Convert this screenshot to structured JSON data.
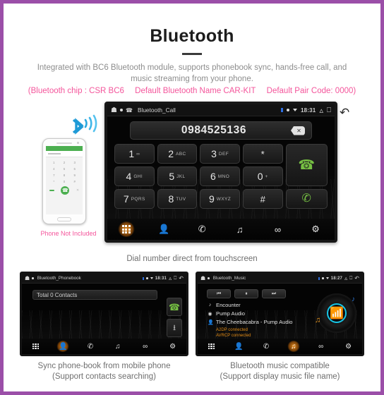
{
  "theme": {
    "border_color": "#9b4fa8",
    "pink": "#f4559b",
    "orange_accent": "#e08a16",
    "green_call": "#76c043",
    "cyan_ring": "#17c6e6"
  },
  "header": {
    "title": "Bluetooth",
    "description_line1": "Integrated with BC6 Bluetooth module, supports phonebook sync, hands-free call, and",
    "description_line2": "music streaming from your phone.",
    "spec_chip": "(Bluetooth chip : CSR BC6",
    "spec_name": "Default Bluetooth Name CAR-KIT",
    "spec_code": "Default Pair Code: 0000)"
  },
  "phone_mock": {
    "note": "Phone Not Included",
    "bluetooth_icon": "bluetooth-signal-icon",
    "keys": [
      "1",
      "2",
      "3",
      "4",
      "5",
      "6",
      "7",
      "8",
      "9",
      "*",
      "0",
      "#"
    ]
  },
  "dialer": {
    "statusbar": {
      "home_icon": "home-icon",
      "title": "Bluetooth_Call",
      "time": "18:31",
      "chevron_icon": "chevron-up-icon",
      "window_icon": "window-icon",
      "back_icon": "back-arrow-icon"
    },
    "number": "0984525136",
    "backspace_icon": "backspace-icon",
    "keys": [
      {
        "digit": "1",
        "letters": "∞"
      },
      {
        "digit": "2",
        "letters": "ABC"
      },
      {
        "digit": "3",
        "letters": "DEF"
      },
      {
        "digit": "*",
        "letters": ""
      },
      {
        "digit": "4",
        "letters": "GHI"
      },
      {
        "digit": "5",
        "letters": "JKL"
      },
      {
        "digit": "6",
        "letters": "MNO"
      },
      {
        "digit": "0",
        "letters": "+"
      },
      {
        "digit": "7",
        "letters": "PQRS"
      },
      {
        "digit": "8",
        "letters": "TUV"
      },
      {
        "digit": "9",
        "letters": "WXYZ"
      },
      {
        "digit": "#",
        "letters": ""
      }
    ],
    "call_button_icon": "phone-call-icon",
    "call_history_button_icon": "phone-history-icon",
    "nav": [
      {
        "name": "keypad",
        "icon": "keypad-icon",
        "active": true
      },
      {
        "name": "contacts",
        "icon": "person-icon",
        "active": false
      },
      {
        "name": "call-log",
        "icon": "phone-log-icon",
        "active": false
      },
      {
        "name": "music",
        "icon": "music-note-icon",
        "active": false
      },
      {
        "name": "pair",
        "icon": "link-icon",
        "active": false
      },
      {
        "name": "settings",
        "icon": "gear-icon",
        "active": false
      }
    ],
    "caption": "Dial number direct from touchscreen"
  },
  "phonebook": {
    "statusbar": {
      "title": "Bluetooth_Phonebook",
      "time": "18:31"
    },
    "search_text": "Total 0 Contacts",
    "call_button_icon": "phone-call-icon",
    "download_button_icon": "download-icon",
    "nav": [
      {
        "name": "keypad",
        "icon": "keypad-icon",
        "active": false
      },
      {
        "name": "contacts",
        "icon": "person-icon",
        "active": true
      },
      {
        "name": "call-log",
        "icon": "phone-log-icon",
        "active": false
      },
      {
        "name": "music",
        "icon": "music-note-icon",
        "active": false
      },
      {
        "name": "pair",
        "icon": "link-icon",
        "active": false
      },
      {
        "name": "settings",
        "icon": "gear-icon",
        "active": false
      }
    ],
    "caption_line1": "Sync phone-book from mobile phone",
    "caption_line2": "(Support contacts searching)"
  },
  "music": {
    "statusbar": {
      "title": "Bluetooth_Music",
      "time": "18:27"
    },
    "controls": [
      {
        "name": "previous",
        "icon": "⏮"
      },
      {
        "name": "pause",
        "icon": "⏸"
      },
      {
        "name": "next",
        "icon": "⏭"
      }
    ],
    "track_title": "Encounter",
    "album": "Pump Audio",
    "artist": "The Cheebacabra - Pump Audio",
    "a2dp_status": "A2DP connected",
    "avrcp_status": "AVRCP connected",
    "disc_icon": "bluetooth-disc-icon",
    "nav": [
      {
        "name": "keypad",
        "icon": "keypad-icon",
        "active": false
      },
      {
        "name": "contacts",
        "icon": "person-icon",
        "active": false
      },
      {
        "name": "call-log",
        "icon": "phone-log-icon",
        "active": false
      },
      {
        "name": "music",
        "icon": "music-note-icon",
        "active": true
      },
      {
        "name": "pair",
        "icon": "link-icon",
        "active": false
      },
      {
        "name": "settings",
        "icon": "gear-icon",
        "active": false
      }
    ],
    "caption_line1": "Bluetooth music compatible",
    "caption_line2": "(Support display music file name)"
  }
}
